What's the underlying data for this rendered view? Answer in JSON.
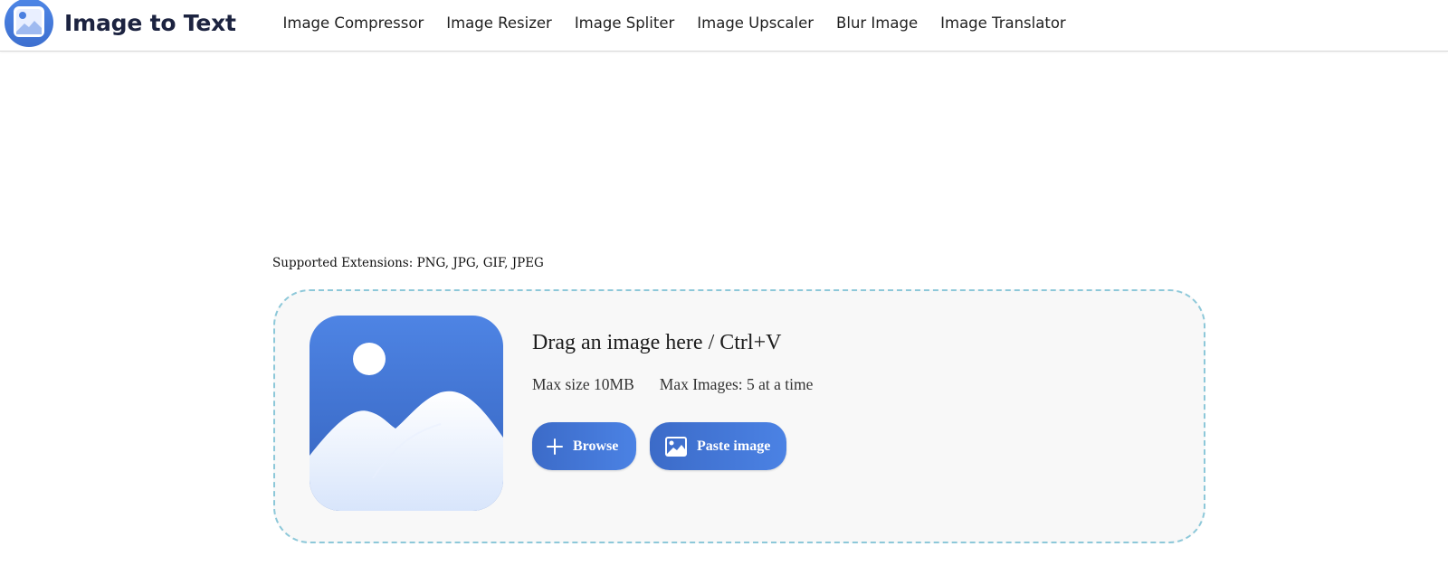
{
  "header": {
    "brand": "Image to Text",
    "nav": [
      {
        "label": "Image Compressor"
      },
      {
        "label": "Image Resizer"
      },
      {
        "label": "Image Spliter"
      },
      {
        "label": "Image Upscaler"
      },
      {
        "label": "Blur Image"
      },
      {
        "label": "Image Translator"
      }
    ]
  },
  "main": {
    "supported_extensions": "Supported Extensions: PNG, JPG, GIF, JPEG",
    "dropzone": {
      "title": "Drag an image here / Ctrl+V",
      "max_size": "Max size 10MB",
      "max_images": "Max Images: 5 at a time",
      "browse_label": "Browse",
      "paste_label": "Paste image"
    }
  },
  "icons": {
    "logo": "image-landscape-icon",
    "dropzone": "image-landscape-icon",
    "browse": "plus-icon",
    "paste": "image-icon"
  },
  "colors": {
    "brand_text": "#1c2340",
    "button_start": "#3c6bc8",
    "button_end": "#4b82e4",
    "dropzone_border": "#8dc8d9",
    "dropzone_bg": "#f8f8f8",
    "icon_blue": "#4a7fe0"
  }
}
